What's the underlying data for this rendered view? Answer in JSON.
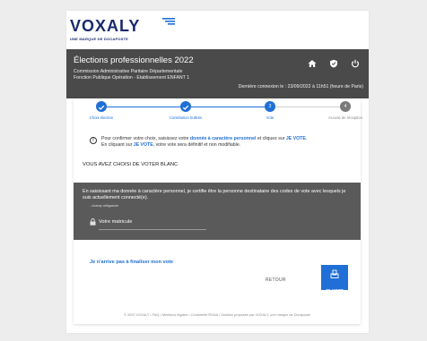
{
  "logo": {
    "word": "VOXALY",
    "sub": "UNE MARQUE DE DOCAPOSTE"
  },
  "banner": {
    "title": "Élections professionnelles 2022",
    "line1": "Commission Administrative Paritaire Départementale",
    "line2": "Fonction Publique Opération - Etablissement ENFANT 1",
    "connexion": "Dernière connexion le : 23/09/2022 à 11h51 (heure de Paris)"
  },
  "stepper": {
    "steps": [
      {
        "label": "Choix élection",
        "state": "done"
      },
      {
        "label": "Constitution bulletin",
        "state": "done"
      },
      {
        "label": "Vote",
        "state": "current",
        "num": "3"
      },
      {
        "label": "Accusé de réception",
        "state": "todo",
        "num": "4"
      }
    ]
  },
  "info": {
    "line_a": "Pour confirmer votre choix, saisissez votre ",
    "hl1": "donnée à caractère personnel",
    "line_b": " et cliquez sur ",
    "hl2": "JE VOTE",
    "line_c": ".",
    "line2_a": "En cliquant sur ",
    "hl3": "JE VOTE",
    "line2_b": ", votre vote sera définitif et non modifiable."
  },
  "blanc": "VOUS AVEZ CHOISI DE VOTER BLANC",
  "certif": {
    "text": "En saisissant ma donnée à caractère personnel, je certifie être la personne destinataire des codes de vote avec lesquels je suis actuellement connecté(e).",
    "small": "- champ obligatoire",
    "matricule_label": "Votre matricule"
  },
  "actions": {
    "finalise": "Je n'arrive pas à finaliser mon vote",
    "retour": "RETOUR",
    "vote": "JE VOTE"
  },
  "footer": "© 2022 VOXALY • FAQ • Mentions légales • Conformité RGAA • Solution proposée par VOXALY, une marque de Docaposte",
  "colors": {
    "accent": "#1f6fd6",
    "banner": "#4a4a4a",
    "dark_box": "#5a5a5a"
  }
}
